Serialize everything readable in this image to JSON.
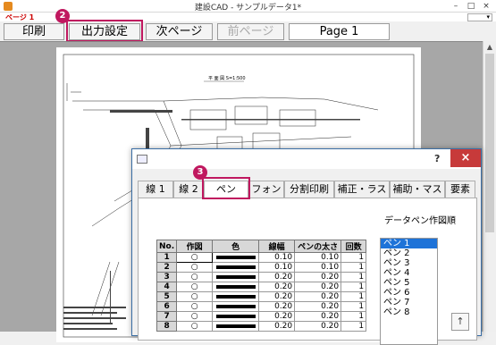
{
  "window": {
    "title": "建設CAD - サンプルデータ1*",
    "minimize": "–",
    "maximize": "□",
    "close": "×"
  },
  "pagebar": {
    "label": "ページ 1",
    "dropdown": "▾"
  },
  "toolbar": {
    "print": "印刷",
    "output_settings": "出力設定",
    "next_page": "次ページ",
    "prev_page": "前ページ",
    "page_field": "Page 1"
  },
  "callouts": {
    "output_settings": "2",
    "pen_tab": "3"
  },
  "drawing": {
    "title": "平 面 図 S=1:500"
  },
  "dialog": {
    "help": "?",
    "close": "×",
    "tabs": [
      "線 1",
      "線 2",
      "ペン",
      "フォント",
      "分割印刷",
      "補正・ラスタ",
      "補助・マスク",
      "要素"
    ],
    "active_tab": "ペン",
    "caption": "データペン作図順",
    "table": {
      "headers": [
        "No.",
        "作図",
        "色",
        "線幅",
        "ペンの太さ",
        "回数"
      ],
      "rows": [
        {
          "no": "1",
          "draw": "○",
          "width": "0.10",
          "pen": "0.10",
          "count": "1"
        },
        {
          "no": "2",
          "draw": "○",
          "width": "0.10",
          "pen": "0.10",
          "count": "1"
        },
        {
          "no": "3",
          "draw": "○",
          "width": "0.20",
          "pen": "0.20",
          "count": "1"
        },
        {
          "no": "4",
          "draw": "○",
          "width": "0.20",
          "pen": "0.20",
          "count": "1"
        },
        {
          "no": "5",
          "draw": "○",
          "width": "0.20",
          "pen": "0.20",
          "count": "1"
        },
        {
          "no": "6",
          "draw": "○",
          "width": "0.20",
          "pen": "0.20",
          "count": "1"
        },
        {
          "no": "7",
          "draw": "○",
          "width": "0.20",
          "pen": "0.20",
          "count": "1"
        },
        {
          "no": "8",
          "draw": "○",
          "width": "0.20",
          "pen": "0.20",
          "count": "1"
        }
      ]
    },
    "pen_list": [
      "ペン 1",
      "ペン 2",
      "ペン 3",
      "ペン 4",
      "ペン 5",
      "ペン 6",
      "ペン 7",
      "ペン 8"
    ],
    "up_button": "↑"
  }
}
